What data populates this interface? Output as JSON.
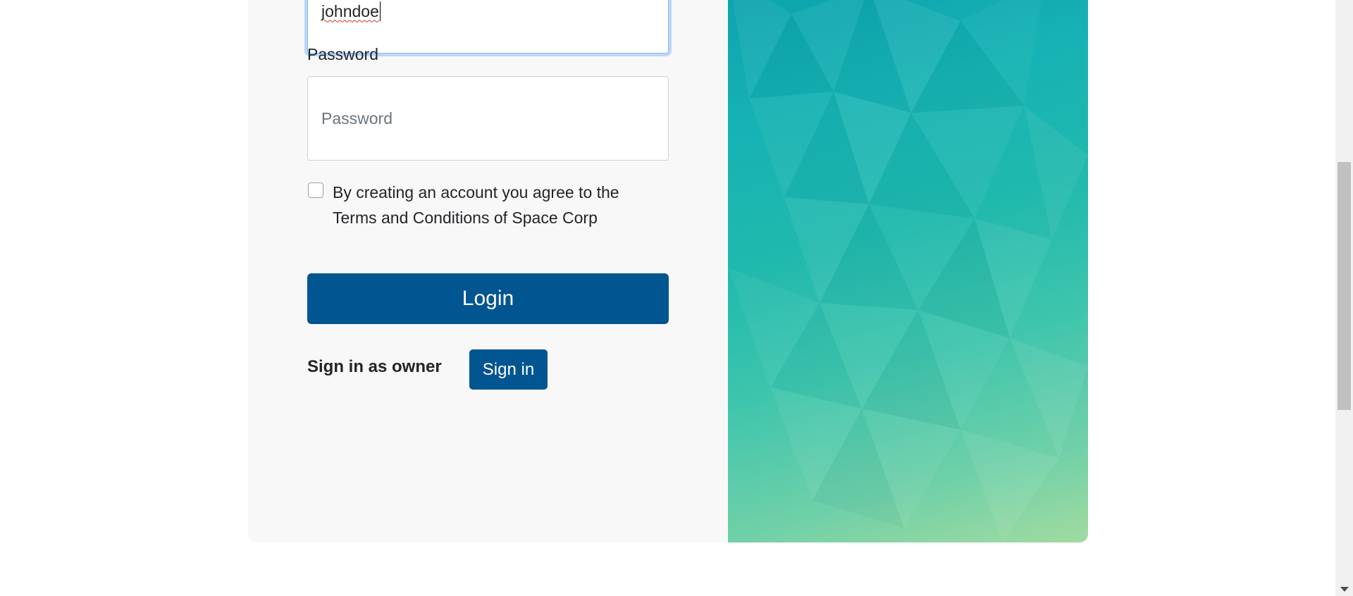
{
  "login_form": {
    "username_value": "johndoe",
    "password_label": "Password",
    "password_placeholder": "Password",
    "terms_text": "By creating an account you agree to the Terms and Conditions of Space Corp",
    "terms_checked": false,
    "login_button_label": "Login",
    "owner_text": "Sign in as owner",
    "signin_button_label": "Sign in"
  },
  "colors": {
    "primary_button": "#015591",
    "card_background": "#f8f8f8",
    "art_gradient_top": "#0aa1ad",
    "art_gradient_bottom": "#a1dba0"
  },
  "decorative": {
    "art_panel": "low-poly-teal-gradient"
  }
}
